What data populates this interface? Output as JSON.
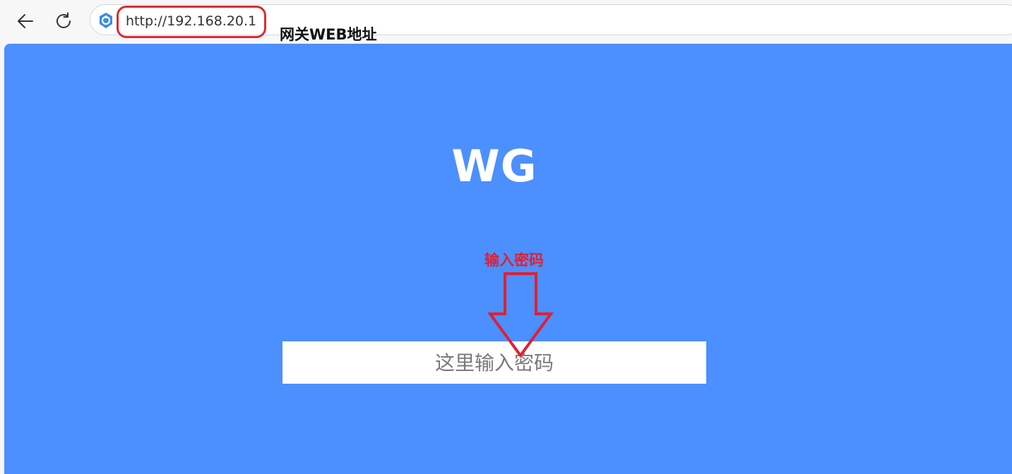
{
  "browser": {
    "url": "http://192.168.20.1"
  },
  "annotations": {
    "url_note": "网关WEB地址",
    "password_note": "输入密码",
    "highlight_color": "#d92b33",
    "arrow_color": "#e02030"
  },
  "page": {
    "logo": "WG",
    "password_input": {
      "placeholder": "这里输入密码",
      "value": ""
    },
    "background_color": "#4c8fff"
  },
  "icons": {
    "back": "arrow-left-icon",
    "reload": "reload-icon",
    "site": "site-shield-icon"
  }
}
